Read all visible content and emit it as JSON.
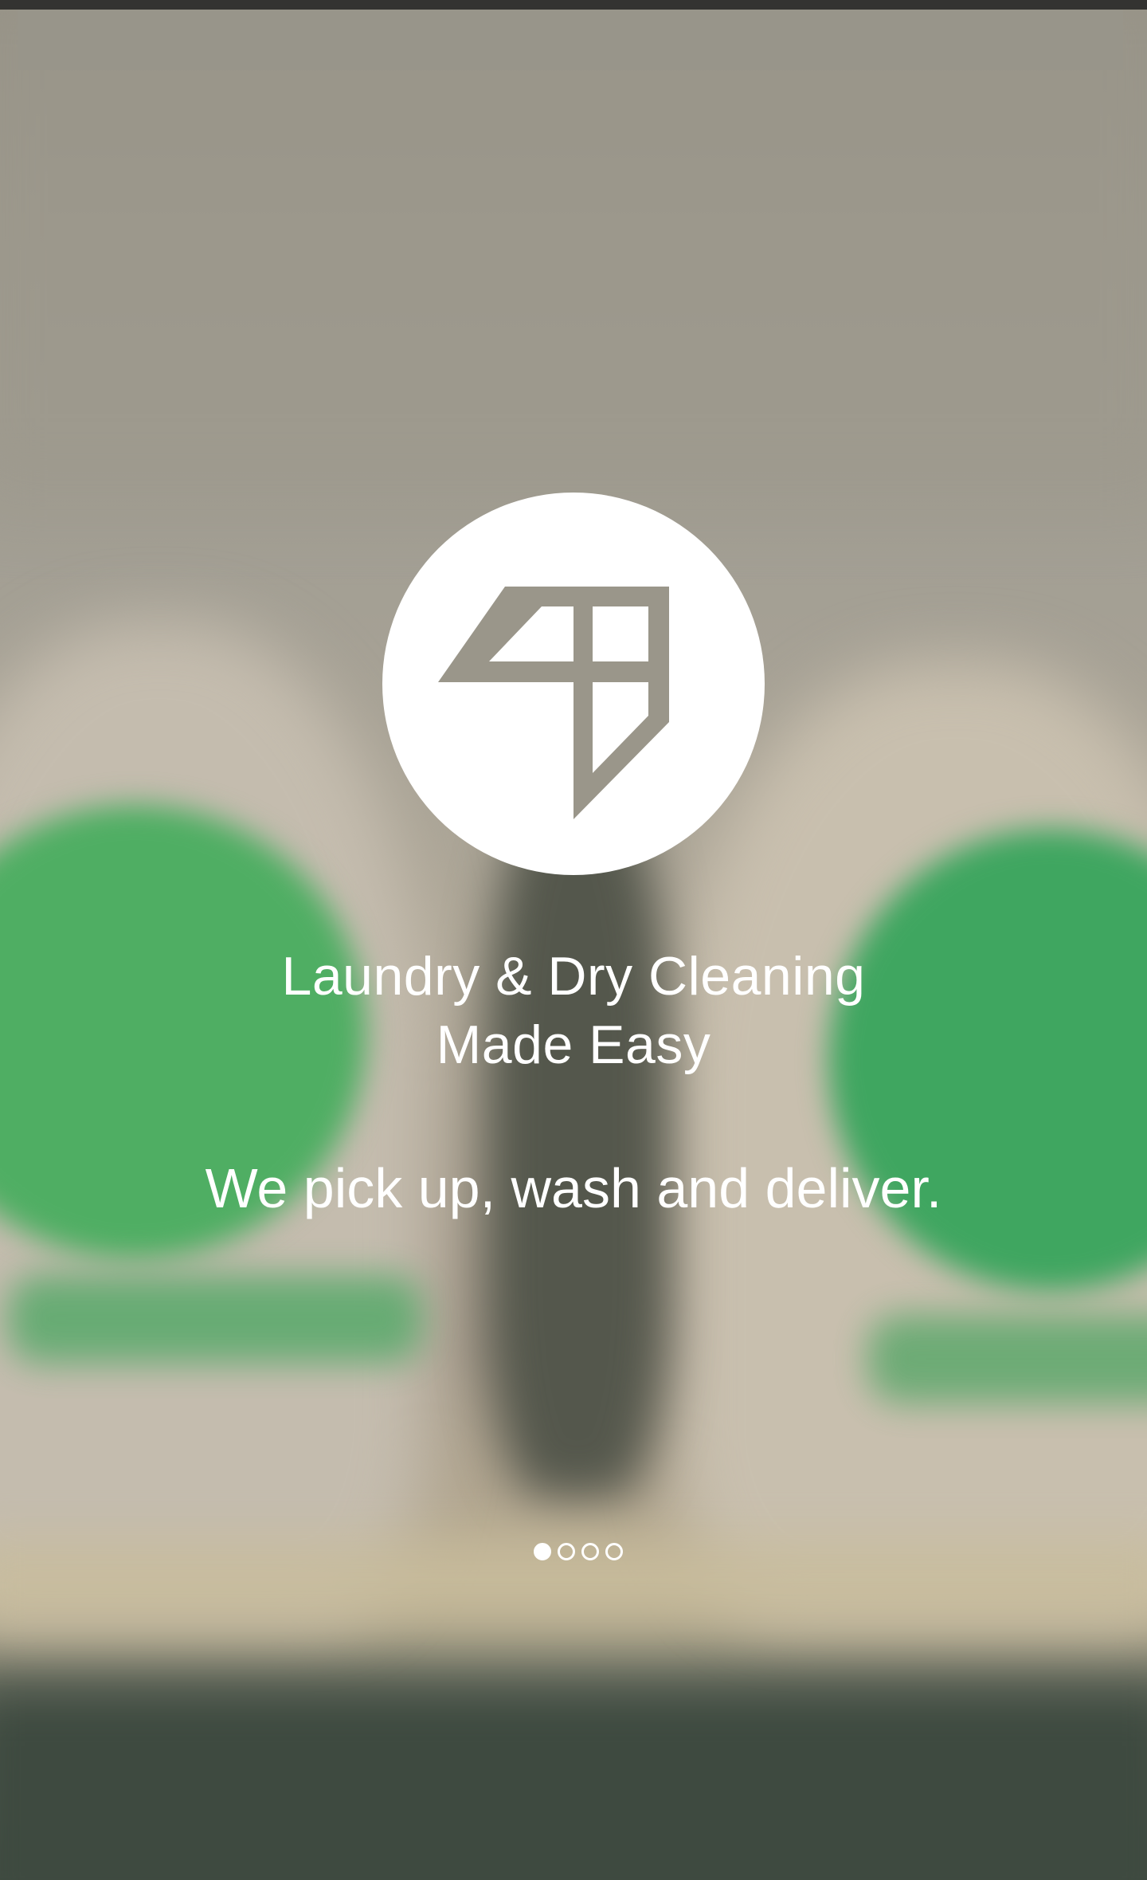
{
  "onboarding": {
    "headline_line1": "Laundry & Dry Cleaning",
    "headline_line2": "Made Easy",
    "tagline": "We pick up, wash and deliver.",
    "logo_icon": "brand-logo-icon",
    "page_indicator": {
      "current": 1,
      "total": 4
    }
  },
  "colors": {
    "logo_background": "#ffffff",
    "logo_mark": "#9a968a",
    "text": "#ffffff"
  }
}
